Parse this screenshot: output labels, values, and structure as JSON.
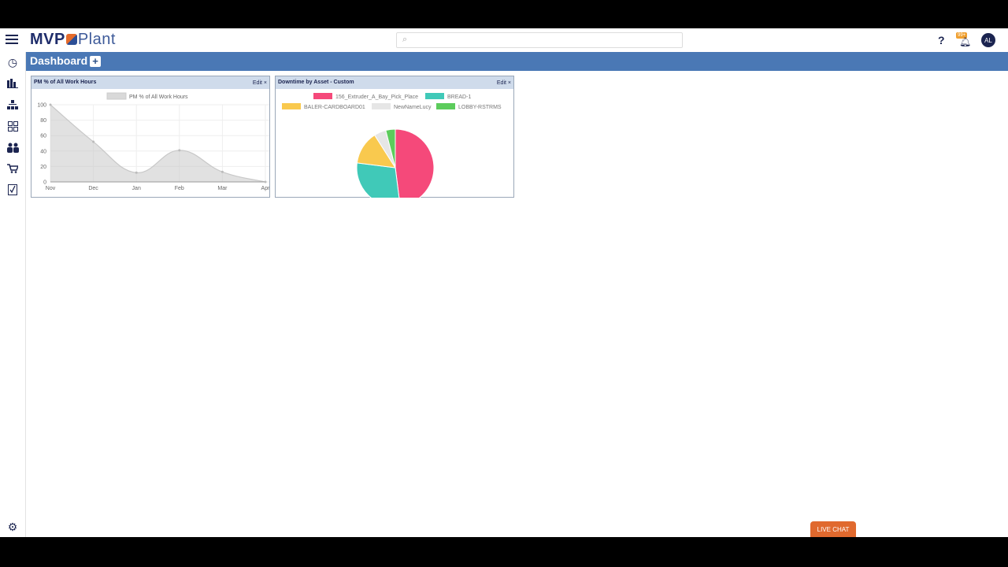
{
  "header": {
    "logo_main": "MVP",
    "logo_sub": "Plant",
    "search_placeholder": "",
    "help": "?",
    "notification_badge": "99+",
    "avatar_initials": "AL"
  },
  "sidebar": {
    "items": [
      "history",
      "reports",
      "hierarchy",
      "qr-codes",
      "users",
      "purchasing",
      "tasks",
      "settings"
    ]
  },
  "dashboard": {
    "title": "Dashboard",
    "add_label": "+"
  },
  "widgets": [
    {
      "title": "PM % of All Work Hours",
      "edit": "Edit ×"
    },
    {
      "title": "Downtime by Asset - Custom",
      "edit": "Edit ×"
    }
  ],
  "live_chat": "LIVE CHAT",
  "chart_data": [
    {
      "type": "area",
      "title": "PM % of All Work Hours",
      "legend": [
        "PM % of All Work Hours"
      ],
      "categories": [
        "Nov",
        "Dec",
        "Jan",
        "Feb",
        "Mar",
        "Apr"
      ],
      "values": [
        100,
        52,
        12,
        41,
        13,
        0
      ],
      "yticks": [
        0,
        20,
        40,
        60,
        80,
        100
      ],
      "ylim": [
        0,
        100
      ],
      "color": "#d9d9d9",
      "grid": true
    },
    {
      "type": "pie",
      "title": "Downtime by Asset - Custom",
      "labels": [
        "156_Extruder_A_Bay_Pick_Place",
        "BREAD-1",
        "BALER-CARDBOARD01",
        "NewNameLucy",
        "LOBBY-RSTRMS"
      ],
      "values": [
        48,
        29,
        14,
        5,
        4
      ],
      "colors": [
        "#f5497a",
        "#40c9b8",
        "#f9c94e",
        "#e6e6e6",
        "#5ccc5c"
      ],
      "legend": "top"
    }
  ]
}
